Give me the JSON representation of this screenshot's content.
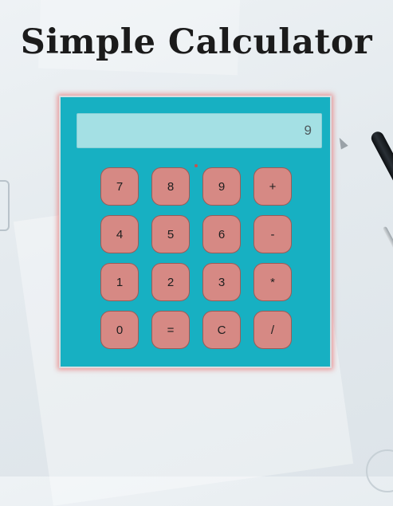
{
  "page": {
    "title": "Simple Calculator"
  },
  "calculator": {
    "display_value": "9",
    "keys": [
      "7",
      "8",
      "9",
      "+",
      "4",
      "5",
      "6",
      "-",
      "1",
      "2",
      "3",
      "*",
      "0",
      "=",
      "C",
      "/"
    ]
  },
  "colors": {
    "calculator_body": "#17b0c2",
    "display_background": "#a4e0e4",
    "key_background": "#d68984",
    "glow": "#e87878"
  }
}
